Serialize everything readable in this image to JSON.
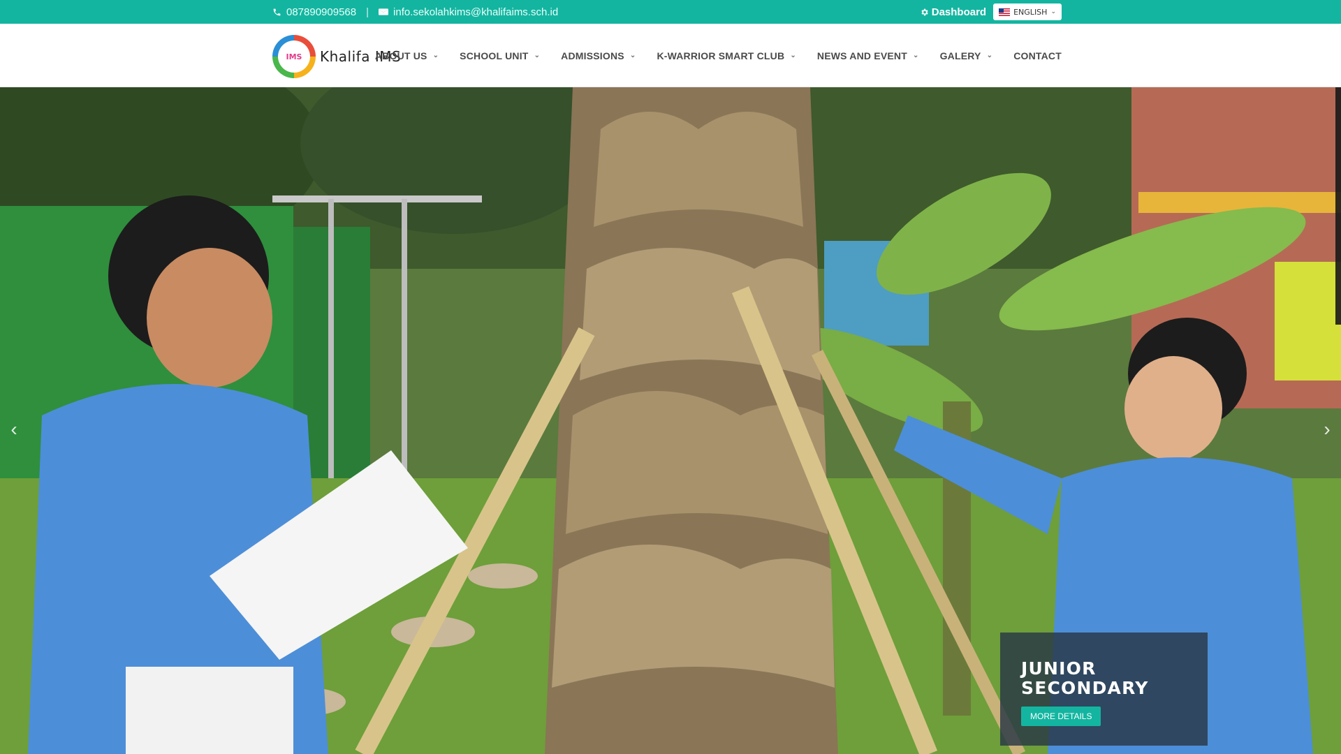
{
  "topbar": {
    "phone": "087890909568",
    "separator": "|",
    "email": "info.sekolahkims@khalifaims.sch.id",
    "dashboard_label": "Dashboard",
    "language_label": "ENGLISH",
    "background_color": "#14b5a0"
  },
  "header": {
    "logo_text": "Khalifa  IMS",
    "logo_mark_text": "IMS",
    "nav": [
      {
        "label": "ABOUT US",
        "has_dropdown": true
      },
      {
        "label": "SCHOOL UNIT",
        "has_dropdown": true
      },
      {
        "label": "ADMISSIONS",
        "has_dropdown": true
      },
      {
        "label": "K-WARRIOR SMART CLUB",
        "has_dropdown": true
      },
      {
        "label": "NEWS AND EVENT",
        "has_dropdown": true
      },
      {
        "label": "GALERY",
        "has_dropdown": true
      },
      {
        "label": "CONTACT",
        "has_dropdown": false
      }
    ]
  },
  "hero": {
    "caption_title": "JUNIOR SECONDARY",
    "caption_button": "MORE DETAILS",
    "prev_icon": "chevron-left-icon",
    "next_icon": "chevron-right-icon",
    "accent_color": "#14b5a0"
  }
}
